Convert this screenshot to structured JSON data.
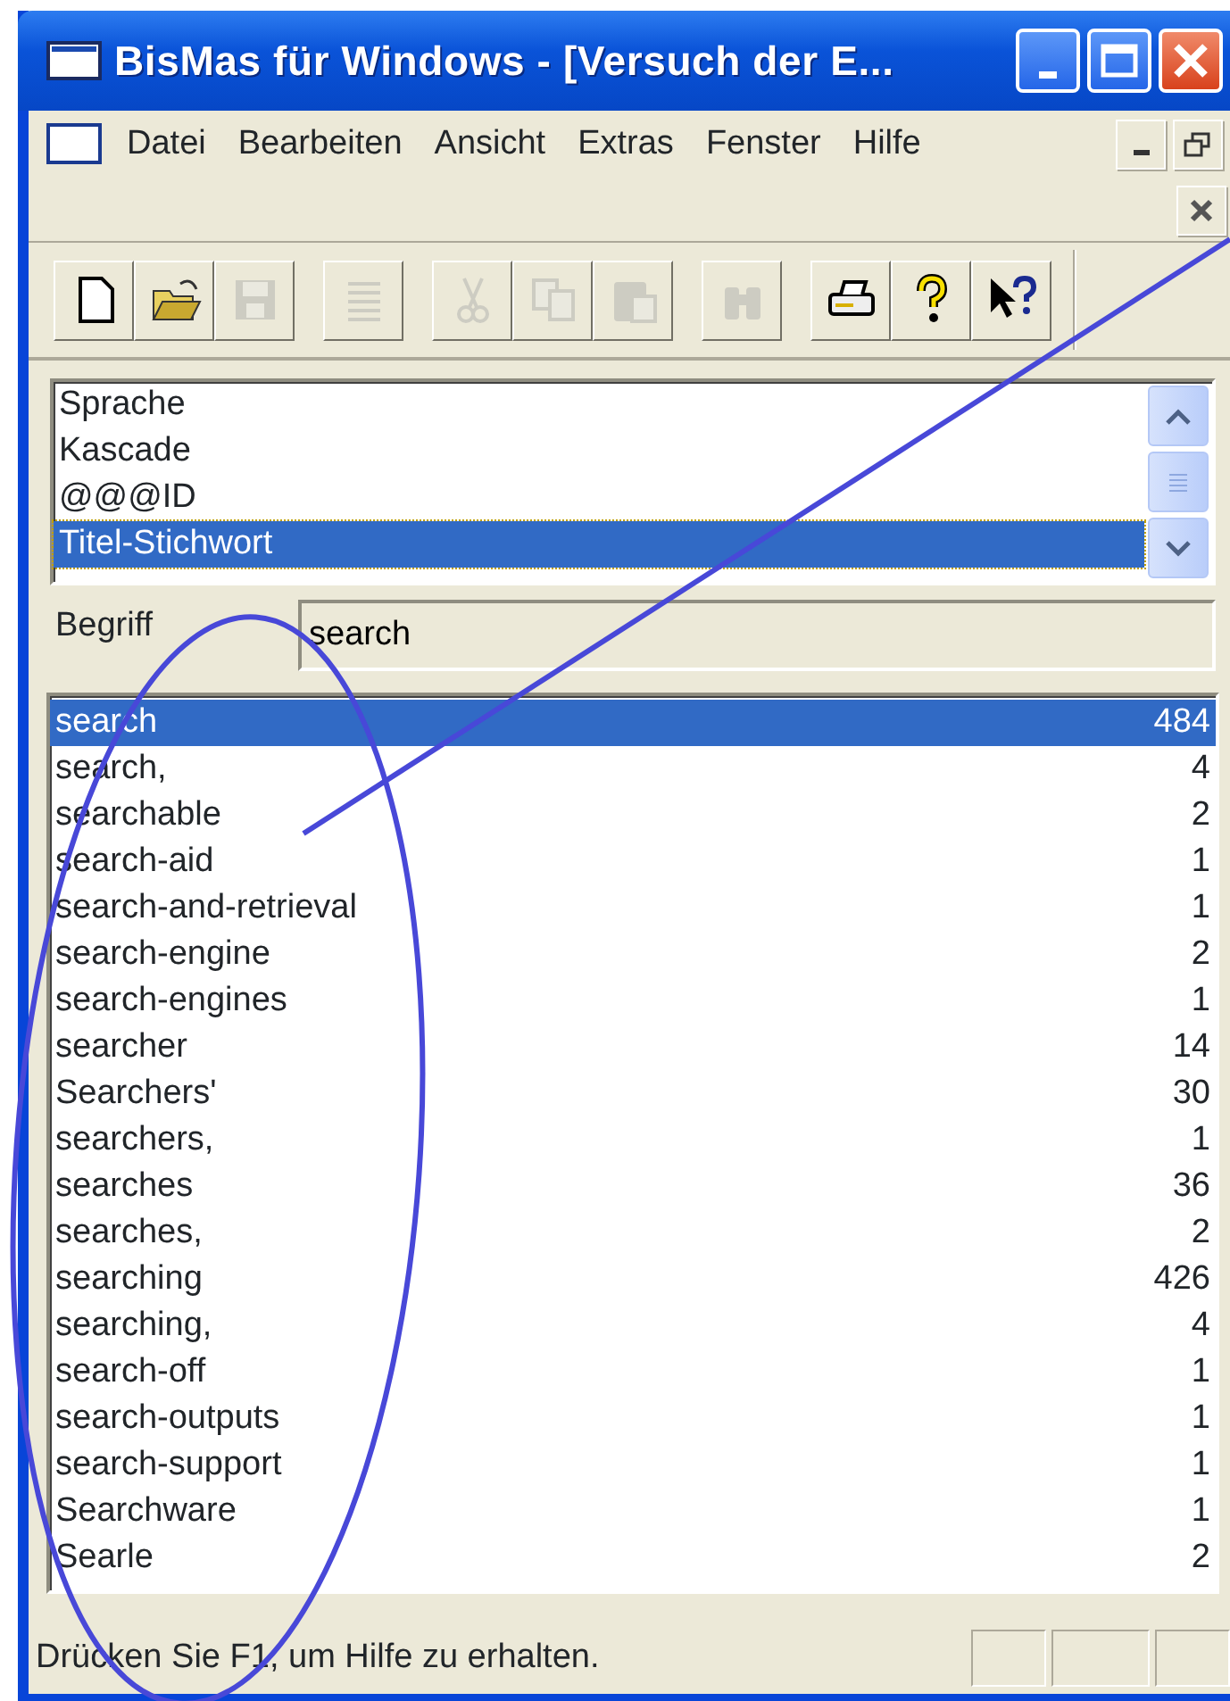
{
  "window": {
    "title": "BisMas für Windows - [Versuch der E..."
  },
  "menu": [
    "Datei",
    "Bearbeiten",
    "Ansicht",
    "Extras",
    "Fenster",
    "Hilfe"
  ],
  "toolbar": [
    {
      "kind": "new",
      "disabled": false
    },
    {
      "kind": "open",
      "disabled": false
    },
    {
      "kind": "save",
      "disabled": true
    },
    {
      "kind": "gap"
    },
    {
      "kind": "lines",
      "disabled": true
    },
    {
      "kind": "gap"
    },
    {
      "kind": "cut",
      "disabled": true
    },
    {
      "kind": "copy",
      "disabled": true
    },
    {
      "kind": "paste",
      "disabled": true
    },
    {
      "kind": "gap"
    },
    {
      "kind": "find",
      "disabled": true
    },
    {
      "kind": "gap"
    },
    {
      "kind": "print",
      "disabled": false
    },
    {
      "kind": "help",
      "disabled": false
    },
    {
      "kind": "context-help",
      "disabled": false
    }
  ],
  "fields": [
    {
      "label": "Sprache",
      "selected": false
    },
    {
      "label": "Kascade",
      "selected": false
    },
    {
      "label": "@@@ID",
      "selected": false
    },
    {
      "label": "Titel-Stichwort",
      "selected": true
    }
  ],
  "term": {
    "label": "Begriff",
    "value": "search"
  },
  "terms": [
    {
      "term": "search",
      "count": "484",
      "selected": true
    },
    {
      "term": "search,",
      "count": "4",
      "selected": false
    },
    {
      "term": "searchable",
      "count": "2",
      "selected": false
    },
    {
      "term": "search-aid",
      "count": "1",
      "selected": false
    },
    {
      "term": "search-and-retrieval",
      "count": "1",
      "selected": false
    },
    {
      "term": "search-engine",
      "count": "2",
      "selected": false
    },
    {
      "term": "search-engines",
      "count": "1",
      "selected": false
    },
    {
      "term": "searcher",
      "count": "14",
      "selected": false
    },
    {
      "term": "Searchers'",
      "count": "30",
      "selected": false
    },
    {
      "term": "searchers,",
      "count": "1",
      "selected": false
    },
    {
      "term": "searches",
      "count": "36",
      "selected": false
    },
    {
      "term": "searches,",
      "count": "2",
      "selected": false
    },
    {
      "term": "searching",
      "count": "426",
      "selected": false
    },
    {
      "term": "searching,",
      "count": "4",
      "selected": false
    },
    {
      "term": "search-off",
      "count": "1",
      "selected": false
    },
    {
      "term": "search-outputs",
      "count": "1",
      "selected": false
    },
    {
      "term": "search-support",
      "count": "1",
      "selected": false
    },
    {
      "term": "Searchware",
      "count": "1",
      "selected": false
    },
    {
      "term": "Searle",
      "count": "2",
      "selected": false
    }
  ],
  "status_bar": {
    "text": "Drücken Sie F1, um Hilfe zu erhalten."
  }
}
